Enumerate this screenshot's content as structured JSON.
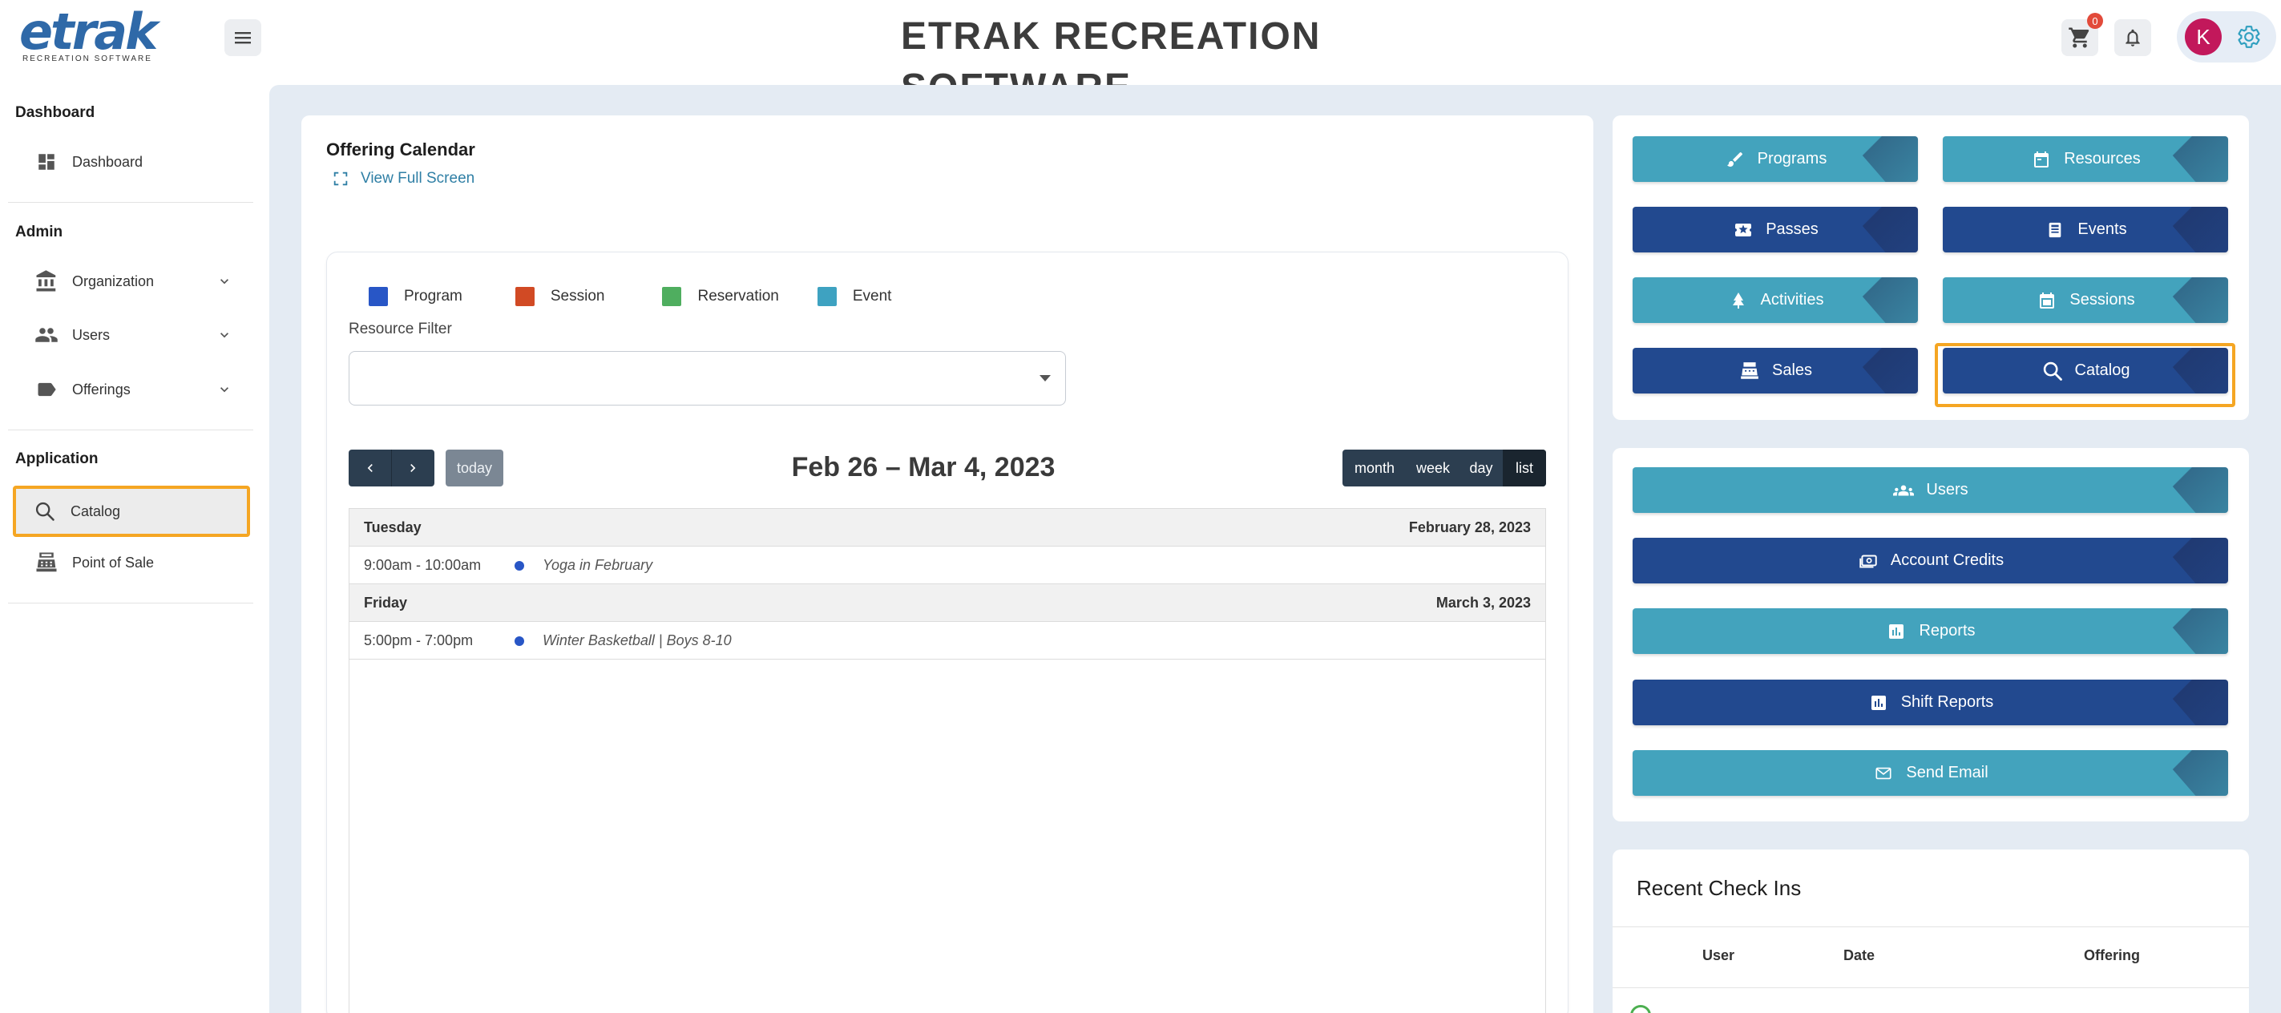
{
  "header": {
    "logo_text": "etrak",
    "logo_subtitle": "RECREATION SOFTWARE",
    "app_title": "ETRAK RECREATION SOFTWARE",
    "cart_count": "0",
    "avatar_initial": "K"
  },
  "sidebar": {
    "sections": [
      {
        "title": "Dashboard",
        "items": [
          {
            "label": "Dashboard",
            "icon": "dashboard-icon"
          }
        ]
      },
      {
        "title": "Admin",
        "items": [
          {
            "label": "Organization",
            "icon": "bank-icon",
            "expandable": true
          },
          {
            "label": "Users",
            "icon": "users-icon",
            "expandable": true
          },
          {
            "label": "Offerings",
            "icon": "tag-icon",
            "expandable": true
          }
        ]
      },
      {
        "title": "Application",
        "items": [
          {
            "label": "Catalog",
            "icon": "search-icon",
            "highlighted": true
          },
          {
            "label": "Point of Sale",
            "icon": "register-icon"
          }
        ]
      }
    ]
  },
  "calendar": {
    "title": "Offering Calendar",
    "fullscreen_label": "View Full Screen",
    "legend": [
      {
        "label": "Program",
        "color": "#2856c6"
      },
      {
        "label": "Session",
        "color": "#d14a24"
      },
      {
        "label": "Reservation",
        "color": "#4fae5f"
      },
      {
        "label": "Event",
        "color": "#3ea2c1"
      }
    ],
    "resource_filter_label": "Resource Filter",
    "resource_filter_value": "",
    "today_label": "today",
    "range_title": "Feb 26 – Mar 4, 2023",
    "views": [
      "month",
      "week",
      "day",
      "list"
    ],
    "active_view": "list",
    "days": [
      {
        "name": "Tuesday",
        "date": "February 28, 2023",
        "events": [
          {
            "time": "9:00am - 10:00am",
            "title": "Yoga in February"
          }
        ]
      },
      {
        "name": "Friday",
        "date": "March 3, 2023",
        "events": [
          {
            "time": "5:00pm - 7:00pm",
            "title": "Winter Basketball | Boys 8-10"
          }
        ]
      }
    ]
  },
  "quick_links": {
    "group1": [
      {
        "label": "Programs",
        "icon": "brush-icon",
        "style": "light"
      },
      {
        "label": "Resources",
        "icon": "calendar-icon",
        "style": "light"
      },
      {
        "label": "Passes",
        "icon": "ticket-icon",
        "style": "dark"
      },
      {
        "label": "Events",
        "icon": "document-icon",
        "style": "dark"
      },
      {
        "label": "Activities",
        "icon": "tree-icon",
        "style": "light"
      },
      {
        "label": "Sessions",
        "icon": "calendar-icon",
        "style": "light"
      },
      {
        "label": "Sales",
        "icon": "register-icon",
        "style": "dark"
      },
      {
        "label": "Catalog",
        "icon": "search-icon",
        "style": "dark",
        "highlighted": true
      }
    ],
    "group2": [
      {
        "label": "Users",
        "icon": "group-icon",
        "style": "light"
      },
      {
        "label": "Account Credits",
        "icon": "credits-icon",
        "style": "dark"
      },
      {
        "label": "Reports",
        "icon": "bar-chart-icon",
        "style": "light"
      },
      {
        "label": "Shift Reports",
        "icon": "bar-chart-icon",
        "style": "dark"
      },
      {
        "label": "Send Email",
        "icon": "mail-icon",
        "style": "light"
      }
    ]
  },
  "checkins": {
    "title": "Recent Check Ins",
    "columns": [
      "User",
      "Date",
      "Offering"
    ]
  }
}
